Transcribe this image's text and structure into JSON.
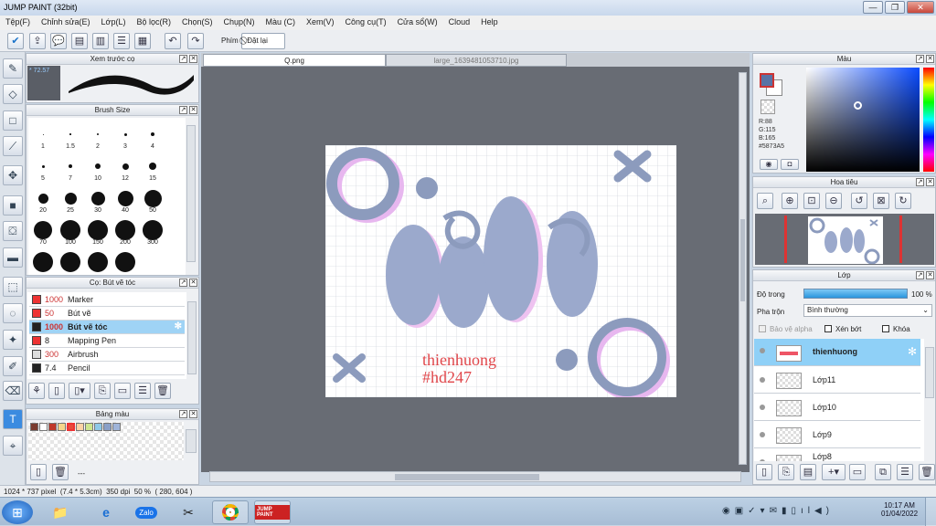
{
  "app": {
    "title": "JUMP PAINT (32bit)",
    "min": "—",
    "max": "❐",
    "close": "✕"
  },
  "menu": [
    "Tệp(F)",
    "Chỉnh sửa(E)",
    "Lớp(L)",
    "Bộ lọc(R)",
    "Chọn(S)",
    "Chụp(N)",
    "Màu (C)",
    "Xem(V)",
    "Công cụ(T)",
    "Cửa sổ(W)",
    "Cloud",
    "Help"
  ],
  "toolbar": {
    "phim_label": "Phím",
    "reset_label": "Đặt lại"
  },
  "tabs": [
    "Q.png",
    "large_1639481053710.jpg"
  ],
  "preview": {
    "title": "Xem trước cọ",
    "size": "72.57"
  },
  "brush_size": {
    "title": "Brush Size",
    "sizes": [
      "1",
      "1.5",
      "2",
      "3",
      "4",
      "5",
      "7",
      "10",
      "12",
      "15",
      "20",
      "25",
      "30",
      "40",
      "50",
      "70",
      "100",
      "150",
      "200",
      "300",
      "",
      "",
      "",
      ""
    ]
  },
  "brushes": {
    "title": "Cọ: Bút vẽ tóc",
    "rows": [
      {
        "size": "1000",
        "name": "Marker",
        "color": "#e33"
      },
      {
        "size": "50",
        "name": "Bút vẽ",
        "color": "#e33"
      },
      {
        "size": "1000",
        "name": "Bút vẽ tóc",
        "color": "#222"
      },
      {
        "size": "8",
        "name": "Mapping Pen",
        "color": "#e33"
      },
      {
        "size": "300",
        "name": "Airbrush",
        "color": "#ddd"
      },
      {
        "size": "7.4",
        "name": "Pencil",
        "color": "#222"
      }
    ]
  },
  "palette": {
    "title": "Bảng màu",
    "colors": [
      "#7a3b2e",
      "#fff",
      "#c0392b",
      "#f6d68b",
      "#e74c3c",
      "#fcd2a5",
      "#cde58f",
      "#8fc9e8",
      "#8aa0c8",
      "#9fb4d9"
    ],
    "dash": "---"
  },
  "color": {
    "title": "Màu",
    "r": "R:88",
    "g": "G:115",
    "b": "B:165",
    "hex": "#5873A5"
  },
  "nav": {
    "title": "Hoa tiêu"
  },
  "layers": {
    "title": "Lớp",
    "opacity_label": "Độ trong",
    "opacity": "100 %",
    "blend_label": "Pha trộn",
    "blend": "Bình thường",
    "alpha_label": "Bảo vệ alpha",
    "clip_label": "Xén bớt",
    "lock_label": "Khóa",
    "rows": [
      "thienhuong",
      "Lớp11",
      "Lớp10",
      "Lớp9",
      "Lớp8"
    ]
  },
  "art": {
    "line1": "thienhuong",
    "line2": "#hd247"
  },
  "status": {
    "size": "1024 * 737 pixel",
    "cm": "(7.4 * 5.3cm)",
    "dpi": "350 dpi",
    "zoom": "50 %",
    "pos": "( 280, 604 )"
  },
  "taskbar": {
    "time": "10:17 AM",
    "date": "01/04/2022",
    "zalo": "Zalo",
    "jp": "JUMP PAINT"
  }
}
